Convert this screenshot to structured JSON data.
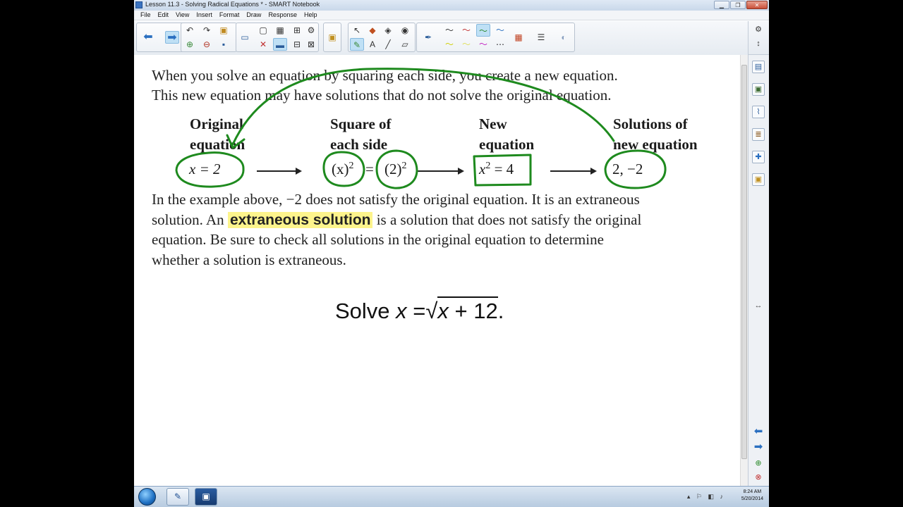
{
  "window": {
    "title": "Lesson 11.3 - Solving Radical Equations * - SMART Notebook",
    "minimize_glyph": "▁",
    "restore_glyph": "❐",
    "close_glyph": "✕"
  },
  "menu": [
    "File",
    "Edit",
    "View",
    "Insert",
    "Format",
    "Draw",
    "Response",
    "Help"
  ],
  "content": {
    "intro_line1": "When you solve an equation by squaring each side, you create a new equation.",
    "intro_line2": "This new equation may have solutions that do not solve the original equation.",
    "headings": {
      "original_1": "Original",
      "original_2": "equation",
      "square_1": "Square of",
      "square_2": "each side",
      "new_1": "New",
      "new_2": "equation",
      "solutions_1": "Solutions of",
      "solutions_2": "new equation"
    },
    "expressions": {
      "original": "x = 2",
      "square_left": "(x)",
      "square_right": "(2)",
      "exponent": "2",
      "new_x": "x",
      "new_rest": " = 4",
      "solutions": "2, −2"
    },
    "explain_line1": "In the example above,  −2 does not satisfy the original equation. It is an extraneous",
    "explain_line2a": "solution. An ",
    "explain_highlight": "extraneous solution",
    "explain_line2b": "  is a solution that does not satisfy the original",
    "explain_line3": "equation. Be sure to check all solutions in the original equation to determine",
    "explain_line4": "whether a solution is extraneous.",
    "solve_prefix": "Solve ",
    "solve_var": "x",
    "solve_equals": " =",
    "solve_radical_sign": "√",
    "solve_radicand_var": "x",
    "solve_radicand_rest": " + 12",
    "solve_period": "."
  },
  "taskbar": {
    "time": "8:24 AM",
    "date": "5/20/2014"
  },
  "colors": {
    "annotation_green": "#1e8a1e",
    "highlight_yellow": "#fdf48c"
  }
}
